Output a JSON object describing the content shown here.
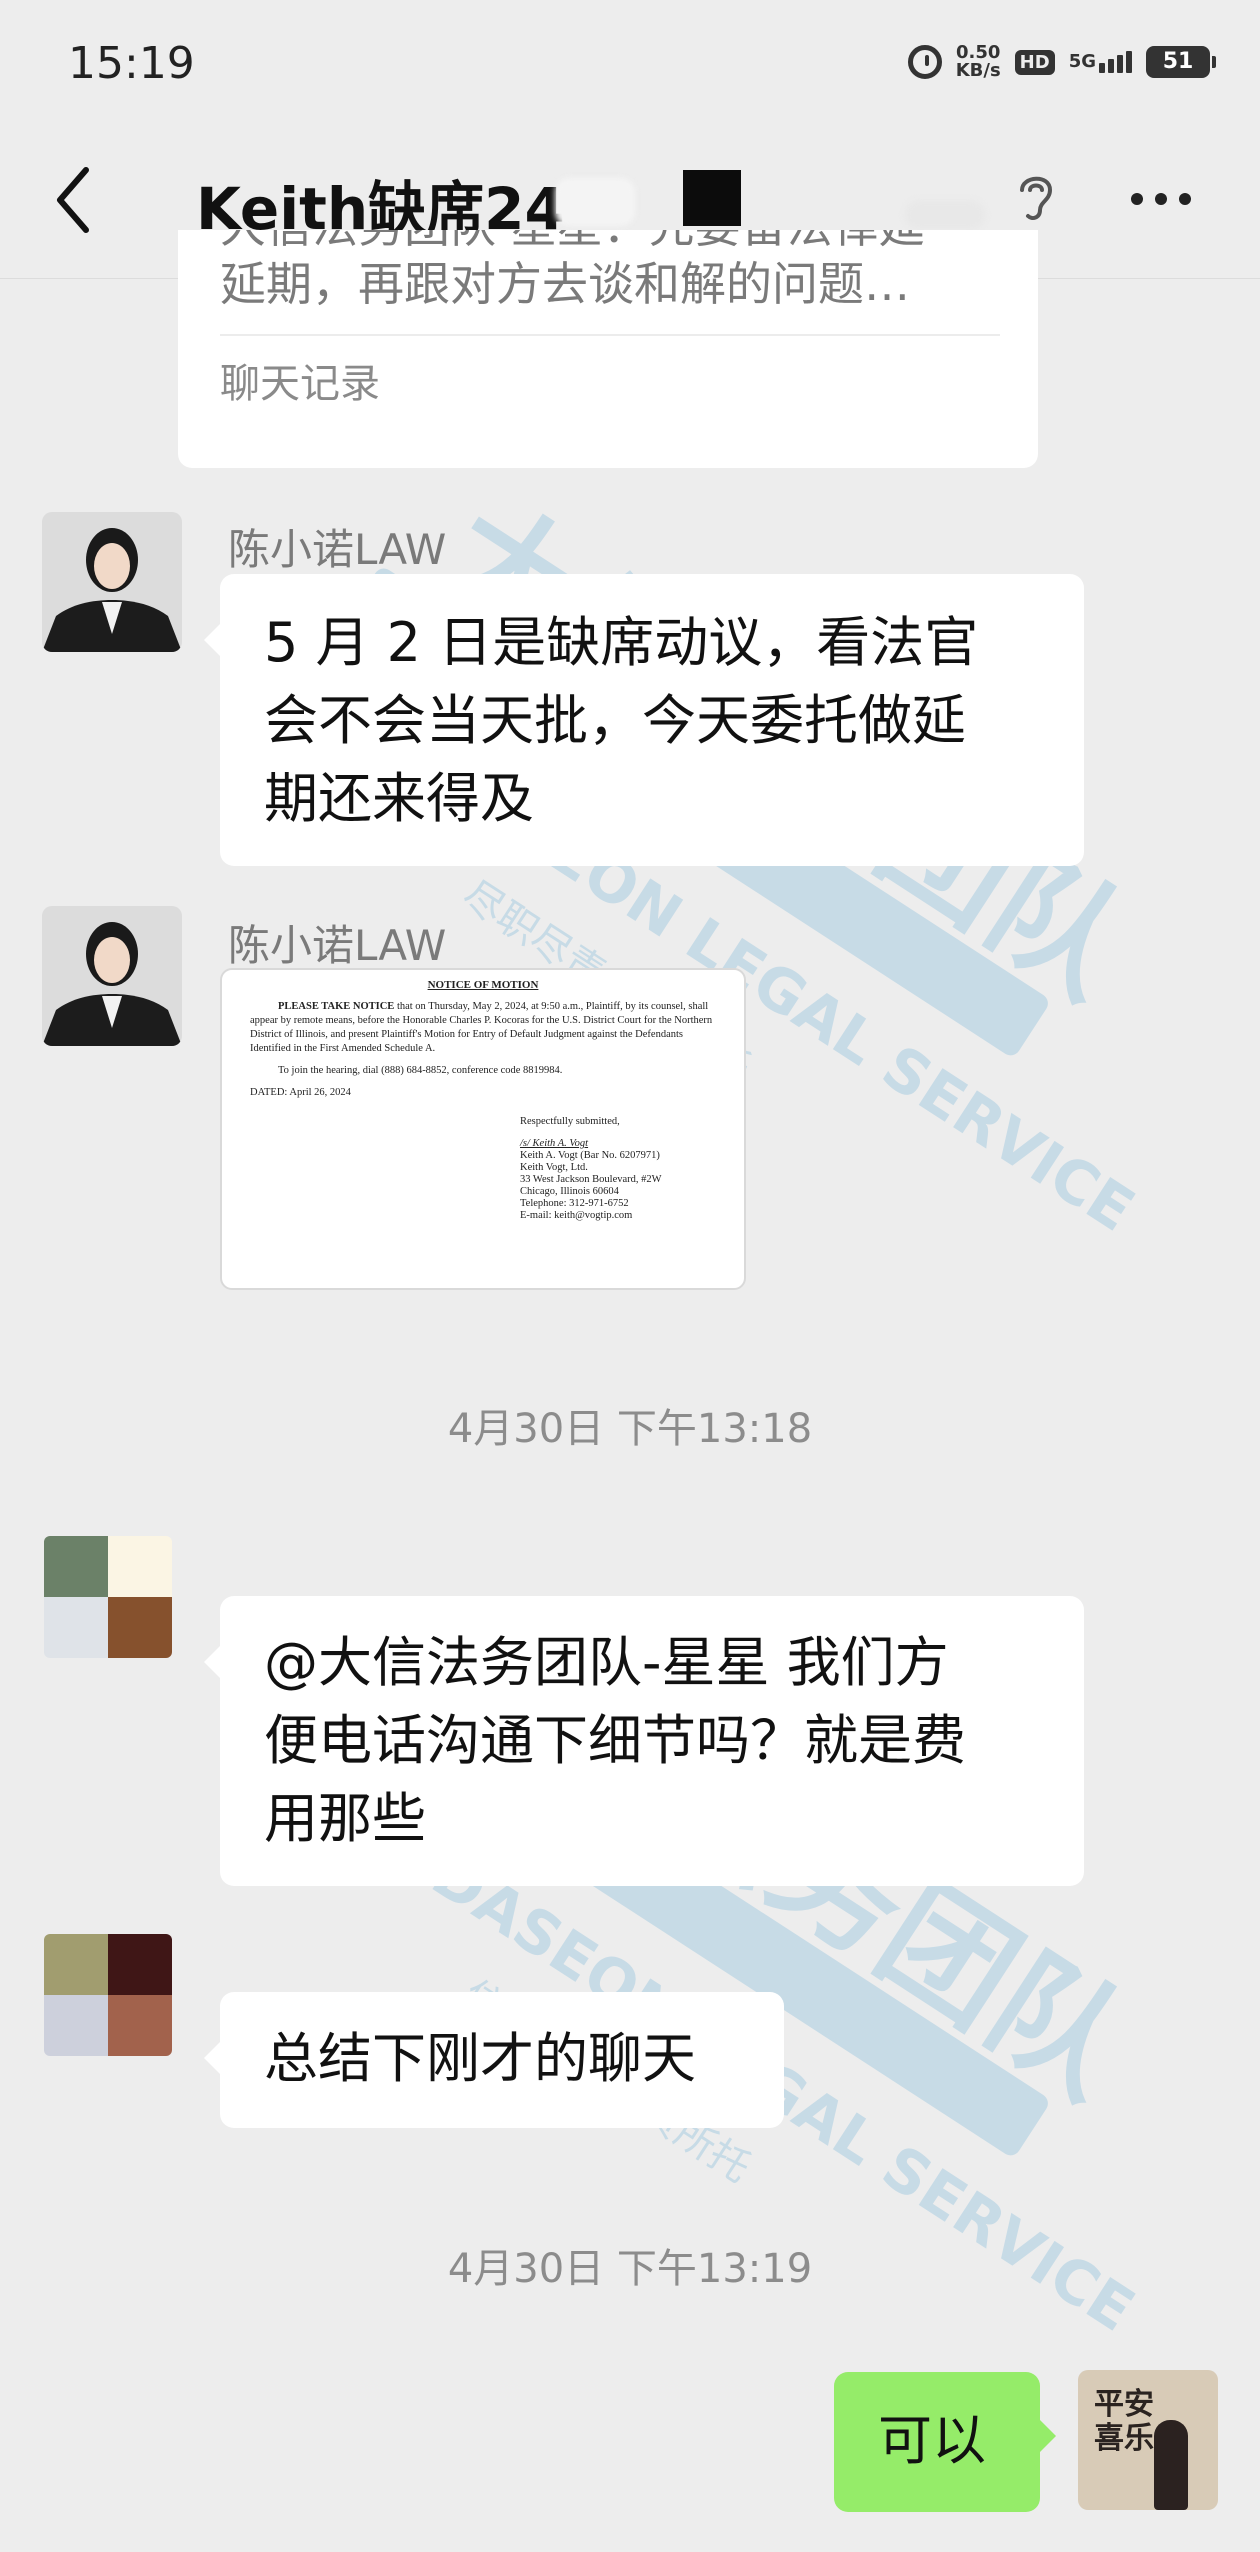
{
  "status_bar": {
    "time": "15:19",
    "speed_value": "0.50",
    "speed_unit": "KB/s",
    "hd": "HD",
    "network": "5G",
    "battery": "51"
  },
  "header": {
    "title": "Keith缺席24-"
  },
  "messages": {
    "forward_card": {
      "preview_line1": "大信法务团队·星星：先要留法律延",
      "preview_line2": "延期，再跟对方去谈和解的问题…",
      "label": "聊天记录"
    },
    "msg1": {
      "sender": "陈小诺LAW",
      "lines": [
        "5 月 2 日是缺席动议，看法官",
        "会不会当天批，今天委托做延",
        "期还来得及"
      ]
    },
    "msg2": {
      "sender": "陈小诺LAW",
      "document": {
        "title": "NOTICE OF MOTION",
        "para1_bold": "PLEASE TAKE NOTICE",
        "para1": " that on Thursday, May 2, 2024, at 9:50 a.m., Plaintiff, by its counsel, shall appear by remote means, before the Honorable Charles P. Kocoras for the U.S. District Court for the Northern District of Illinois, and present Plaintiff's Motion for Entry of Default Judgment against the Defendants Identified in the First Amended Schedule A.",
        "para2": "To join the hearing, dial (888) 684-8852, conference code 8819984.",
        "dated": "DATED:  April 26, 2024",
        "signoff": "Respectfully submitted,",
        "sig_lines": [
          "/s/ Keith A. Vogt",
          "Keith A. Vogt (Bar No. 6207971)",
          "Keith Vogt, Ltd.",
          "33 West Jackson Boulevard, #2W",
          "Chicago, Illinois 60604",
          "Telephone: 312-971-6752",
          "E-mail:  keith@vogtip.com"
        ]
      }
    },
    "time1": "4月30日 下午13:18",
    "msg3": {
      "lines": [
        "@大信法务团队-星星  我们方",
        "便电话沟通下细节吗？就是费",
        "用那些"
      ]
    },
    "msg4": {
      "text": "总结下刚才的聊天"
    },
    "time2": "4月30日 下午13:19",
    "msg5": {
      "text": "可以"
    }
  },
  "self_avatar_text": "平安喜乐",
  "colors": {
    "background": "#ededed",
    "bubble": "#ffffff",
    "self_bubble": "#95ec69",
    "watermark": "#9bc6df"
  },
  "icons": [
    "back-icon",
    "ear-icon",
    "more-icon",
    "alarm-icon"
  ]
}
